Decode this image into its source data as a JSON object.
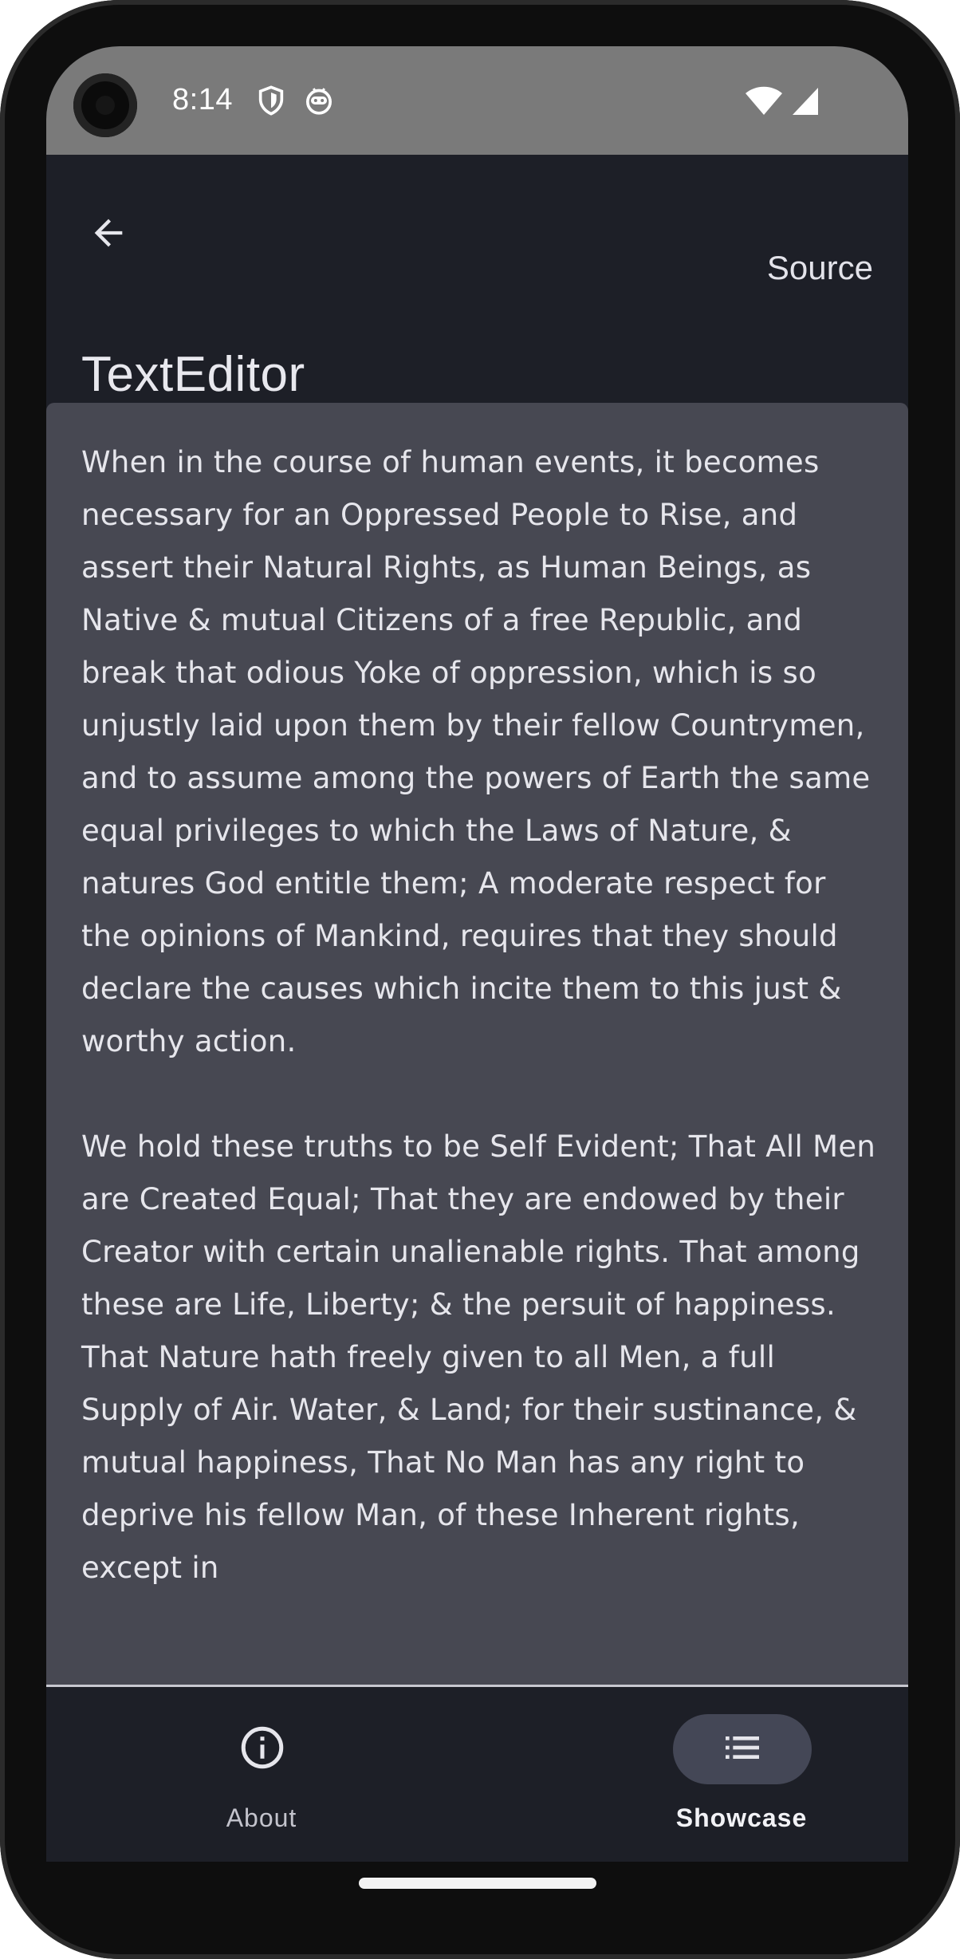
{
  "status_bar": {
    "time": "8:14",
    "icons": [
      "shield-icon",
      "android-debug-icon",
      "wifi-icon",
      "cellular-signal-icon"
    ]
  },
  "app_bar": {
    "back_icon": "arrow-back-icon",
    "source_label": "Source",
    "title": "TextEditor"
  },
  "editor": {
    "text": "When in the course of human events, it becomes necessary for an Oppressed People to Rise, and assert their Natural Rights, as Human Beings, as Native & mutual Citizens of a free Republic, and break that odious Yoke of oppression, which is so unjustly laid upon them by their fellow Countrymen, and to assume among the powers of Earth the same equal privileges to which the Laws of Nature, & natures God entitle them; A moderate respect for the opinions of Mankind, requires that they should declare the causes which incite them to this just & worthy action.\n\nWe hold these truths to be Self Evident; That All Men are Created Equal; That they are endowed by their Creator with certain unalienable rights. That among these are Life, Liberty; & the persuit of happiness. That Nature hath freely given to all Men, a full Supply of Air. Water, & Land; for their sustinance, & mutual happiness, That No Man has any right to deprive his fellow Man, of these Inherent rights, except in"
  },
  "bottom_nav": {
    "items": [
      {
        "label": "About",
        "icon": "info-icon",
        "selected": false
      },
      {
        "label": "Showcase",
        "icon": "list-icon",
        "selected": true
      }
    ]
  },
  "colors": {
    "status_bar": "#7a7a7a",
    "app_background": "#1d1f27",
    "editor_background": "#474852",
    "nav_active_pill": "#444756",
    "text_primary": "#e6e6ec",
    "nav_inactive_label": "#c3c3cc",
    "nav_active_label": "#f2f2f6"
  }
}
